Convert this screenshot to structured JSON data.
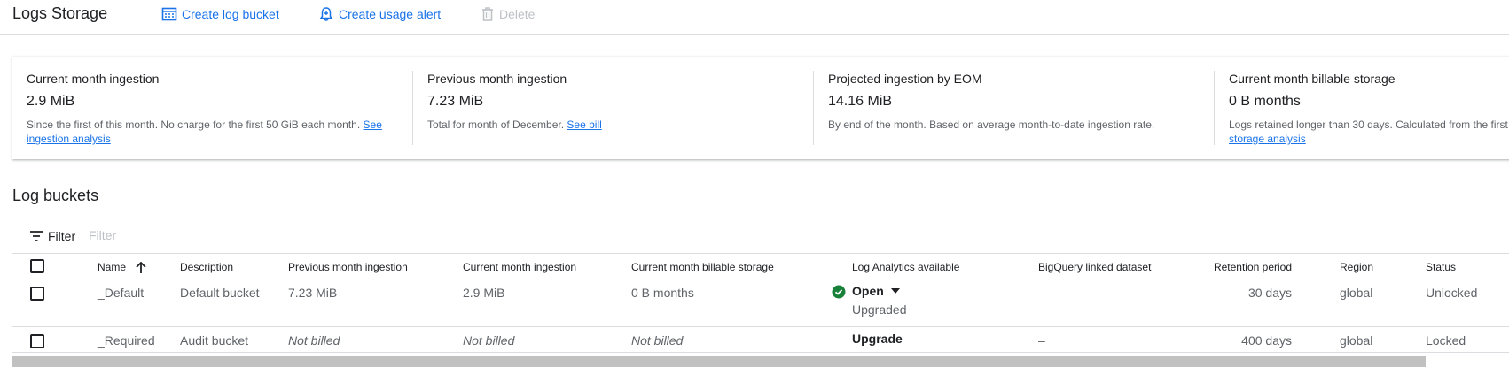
{
  "header": {
    "title": "Logs Storage",
    "create_bucket_label": "Create log bucket",
    "create_alert_label": "Create usage alert",
    "delete_label": "Delete"
  },
  "cards": [
    {
      "title": "Current month ingestion",
      "value": "2.9 MiB",
      "desc": "Since the first of this month. No charge for the first 50 GiB each month.",
      "link": "See ingestion analysis"
    },
    {
      "title": "Previous month ingestion",
      "value": "7.23 MiB",
      "desc": "Total for month of December.",
      "link": "See bill"
    },
    {
      "title": "Projected ingestion by EOM",
      "value": "14.16 MiB",
      "desc": "By end of the month. Based on average month-to-date ingestion rate.",
      "link": ""
    },
    {
      "title": "Current month billable storage",
      "value": "0 B months",
      "desc": "Logs retained longer than 30 days. Calculated from the first",
      "link": "storage analysis"
    }
  ],
  "section": {
    "title": "Log buckets",
    "filter_label": "Filter",
    "filter_placeholder": "Filter"
  },
  "table": {
    "columns": {
      "name": "Name",
      "description": "Description",
      "prev": "Previous month ingestion",
      "current": "Current month ingestion",
      "billable": "Current month billable storage",
      "log_analytics": "Log Analytics available",
      "bigquery": "BigQuery linked dataset",
      "retention": "Retention period",
      "region": "Region",
      "status": "Status"
    },
    "rows": [
      {
        "name": "_Default",
        "description": "Default bucket",
        "prev": "7.23 MiB",
        "current": "2.9 MiB",
        "billable": "0 B months",
        "log_analytics": "Open",
        "log_analytics_sub": "Upgraded",
        "bigquery": "–",
        "retention": "30 days",
        "region": "global",
        "status": "Unlocked"
      },
      {
        "name": "_Required",
        "description": "Audit bucket",
        "prev": "Not billed",
        "current": "Not billed",
        "billable": "Not billed",
        "log_analytics": "Upgrade",
        "bigquery": "–",
        "retention": "400 days",
        "region": "global",
        "status": "Locked"
      }
    ]
  },
  "colors": {
    "accent": "#1a73e8",
    "success": "#188038",
    "disabled": "#bdc1c6"
  },
  "icons": [
    "create-bucket-icon",
    "alert-icon",
    "trash-icon",
    "filter-icon",
    "sort-arrow-up-icon",
    "check-circle-icon",
    "caret-down-icon"
  ]
}
